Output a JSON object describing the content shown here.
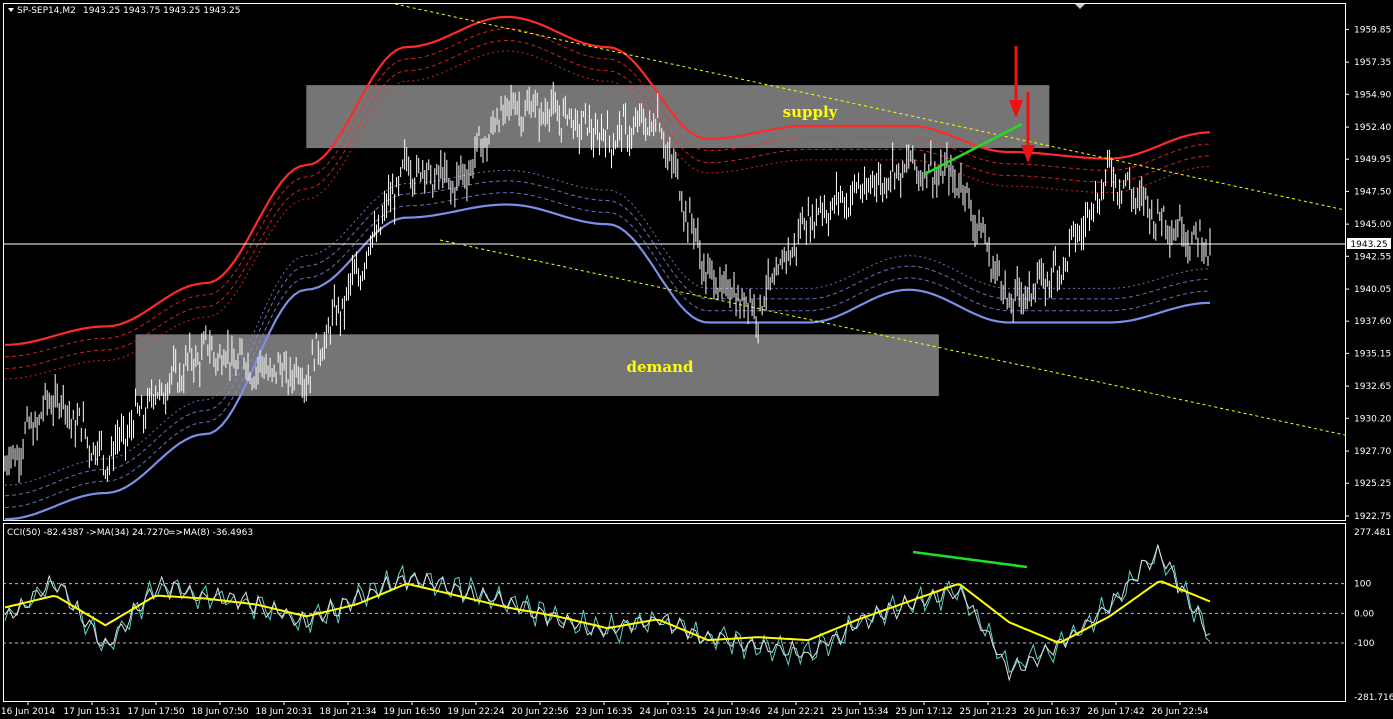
{
  "header": {
    "symbol_label": "SP-SEP14,M2",
    "ohlc": "1943.25 1943.75 1943.25 1943.25"
  },
  "indicator_header": {
    "cci": "CCI(50) -82.4387",
    "ma34": "->MA(34) 24.7270",
    "ma8": "=>MA(8) -36.4963"
  },
  "zones": {
    "supply_label": "supply",
    "demand_label": "demand"
  },
  "colors": {
    "background": "#000000",
    "price_bars": "#ffffff",
    "upper_band": "#ff2a2a",
    "lower_band": "#7b8fe8",
    "zone_fill": "#8a8a8a",
    "trendline": "#ffff00",
    "cci": "#5fd0c8",
    "cci_ma": "#ffff00",
    "divergence": "#22dd22",
    "arrow": "#ee1111"
  },
  "chart_data": [
    {
      "type": "line",
      "ylim": [
        1922.75,
        1961.25
      ],
      "y_ticks": [
        "1959.85",
        "1957.35",
        "1954.90",
        "1952.40",
        "1949.95",
        "1947.50",
        "1945.00",
        "1942.55",
        "1940.05",
        "1937.60",
        "1935.15",
        "1932.65",
        "1930.20",
        "1927.70",
        "1925.25",
        "1922.75"
      ],
      "current_price": "1943.25",
      "x_tick_labels": [
        "16 Jun 2014",
        "17 Jun 15:31",
        "17 Jun 17:50",
        "18 Jun 07:50",
        "18 Jun 20:31",
        "18 Jun 21:34",
        "19 Jun 16:50",
        "19 Jun 22:24",
        "20 Jun 22:56",
        "23 Jun 16:35",
        "24 Jun 03:15",
        "24 Jun 19:46",
        "24 Jun 22:21",
        "25 Jun 15:34",
        "25 Jun 17:12",
        "25 Jun 21:23",
        "26 Jun 16:37",
        "26 Jun 17:42",
        "26 Jun 22:54"
      ],
      "bar_index": [
        0,
        25,
        50,
        75,
        100,
        125,
        150,
        175,
        200,
        225,
        250,
        275,
        300,
        325,
        350,
        375,
        400,
        425,
        450,
        475,
        500,
        525,
        550,
        575,
        600
      ],
      "close": [
        1926.5,
        1932.0,
        1927.0,
        1932.0,
        1935.5,
        1934.0,
        1933.5,
        1941.0,
        1949.5,
        1948.0,
        1954.0,
        1953.5,
        1951.5,
        1953.0,
        1941.0,
        1938.5,
        1945.5,
        1947.5,
        1949.5,
        1948.5,
        1939.0,
        1941.5,
        1949.0,
        1945.5,
        1943.25
      ],
      "series": [
        {
          "name": "",
          "x": [
            0,
            50,
            100,
            150,
            200,
            250,
            300,
            350,
            400,
            450,
            500,
            550,
            600
          ],
          "values": [
            1935.8,
            1937.2,
            1940.5,
            1949.5,
            1958.5,
            1960.8,
            1958.5,
            1951.5,
            1952.5,
            1952.5,
            1950.5,
            1950.0,
            1952.0
          ]
        },
        {
          "name": "",
          "x": [
            0,
            50,
            100,
            150,
            200,
            250,
            300,
            350,
            400,
            450,
            500,
            550,
            600
          ],
          "values": [
            1922.5,
            1924.5,
            1929.0,
            1940.0,
            1945.5,
            1946.5,
            1945.0,
            1937.5,
            1937.5,
            1940.0,
            1937.5,
            1937.5,
            1939.0
          ]
        }
      ],
      "zones": [
        {
          "name": "supply",
          "x_from": 150,
          "x_to": 520,
          "y_from": 1950.8,
          "y_to": 1955.6
        },
        {
          "name": "demand",
          "x_from": 65,
          "x_to": 465,
          "y_from": 1931.9,
          "y_to": 1936.6
        }
      ]
    },
    {
      "type": "line",
      "ylim": [
        -281.7165,
        277.481
      ],
      "y_ticks": [
        "277.481",
        "100",
        "0.00",
        "-100",
        "-281.7165"
      ],
      "x": [
        0,
        25,
        50,
        75,
        100,
        125,
        150,
        175,
        200,
        225,
        250,
        275,
        300,
        325,
        350,
        375,
        400,
        425,
        450,
        475,
        500,
        525,
        550,
        575,
        600
      ],
      "series": [
        {
          "name": "",
          "values": [
            -20,
            110,
            -120,
            90,
            60,
            30,
            -30,
            50,
            120,
            80,
            40,
            -20,
            -60,
            -20,
            -80,
            -110,
            -140,
            -30,
            30,
            80,
            -190,
            -110,
            30,
            210,
            -80
          ]
        },
        {
          "name": "",
          "values": [
            20,
            60,
            -40,
            60,
            50,
            30,
            -10,
            30,
            100,
            60,
            20,
            -10,
            -50,
            -20,
            -90,
            -80,
            -90,
            -20,
            40,
            100,
            -30,
            -100,
            -10,
            110,
            40
          ]
        }
      ]
    }
  ]
}
